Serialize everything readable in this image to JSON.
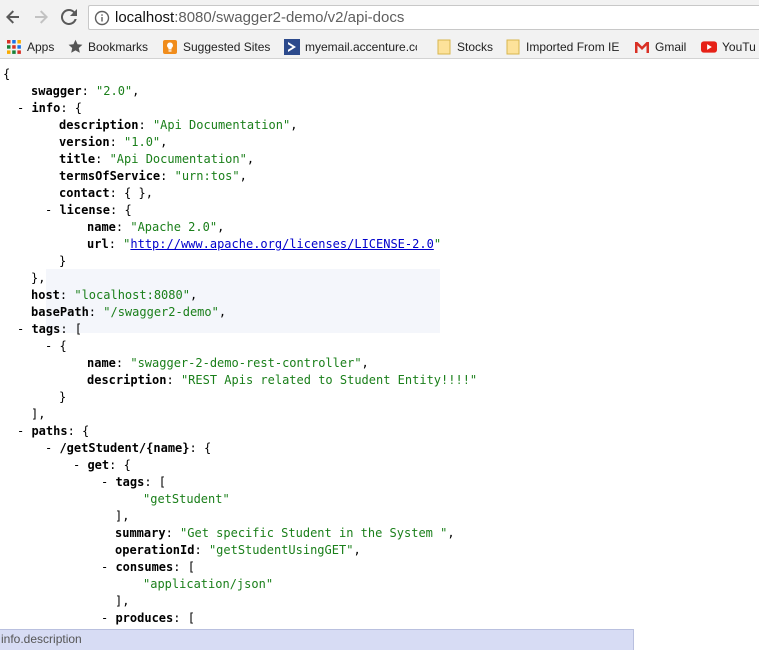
{
  "browser": {
    "url_host": "localhost",
    "url_rest": ":8080/swagger2-demo/v2/api-docs"
  },
  "bookmarks": [
    {
      "label": "Apps",
      "icon": "apps-grid-icon"
    },
    {
      "label": "Bookmarks",
      "icon": "star-icon"
    },
    {
      "label": "Suggested Sites",
      "icon": "suggested-sites-icon"
    },
    {
      "label": "myemail.accenture.cc",
      "icon": "accenture-icon"
    },
    {
      "label": "Stocks",
      "icon": "folder-icon"
    },
    {
      "label": "Imported From IE",
      "icon": "folder-icon"
    },
    {
      "label": "Gmail",
      "icon": "gmail-icon"
    },
    {
      "label": "YouTu",
      "icon": "youtube-icon"
    }
  ],
  "json_view": {
    "l01": "{",
    "l02_key": "swagger",
    "l02_val": "\"2.0\"",
    "l03_key": "info",
    "l04_key": "description",
    "l04_val": "\"Api Documentation\"",
    "l05_key": "version",
    "l05_val": "\"1.0\"",
    "l06_key": "title",
    "l06_val": "\"Api Documentation\"",
    "l07_key": "termsOfService",
    "l07_val": "\"urn:tos\"",
    "l08_key": "contact",
    "l08_val": "{ }",
    "l09_key": "license",
    "l10_key": "name",
    "l10_val": "\"Apache 2.0\"",
    "l11_key": "url",
    "l11_link": "http://www.apache.org/licenses/LICENSE-2.0",
    "l14_key": "host",
    "l14_val": "\"localhost:8080\"",
    "l15_key": "basePath",
    "l15_val": "\"/swagger2-demo\"",
    "l16_key": "tags",
    "l18_key": "name",
    "l18_val": "\"swagger-2-demo-rest-controller\"",
    "l19_key": "description",
    "l19_val": "\"REST Apis related to Student Entity!!!!\"",
    "l22_key": "paths",
    "l23_key": "/getStudent/{name}",
    "l24_key": "get",
    "l25_key": "tags",
    "l26_val": "\"getStudent\"",
    "l28_key": "summary",
    "l28_val": "\"Get specific Student in the System \"",
    "l29_key": "operationId",
    "l29_val": "\"getStudentUsingGET\"",
    "l30_key": "consumes",
    "l31_val": "\"application/json\"",
    "l33_key": "produces",
    "l34_val": "\"*/*\""
  },
  "status_text": "info.description"
}
